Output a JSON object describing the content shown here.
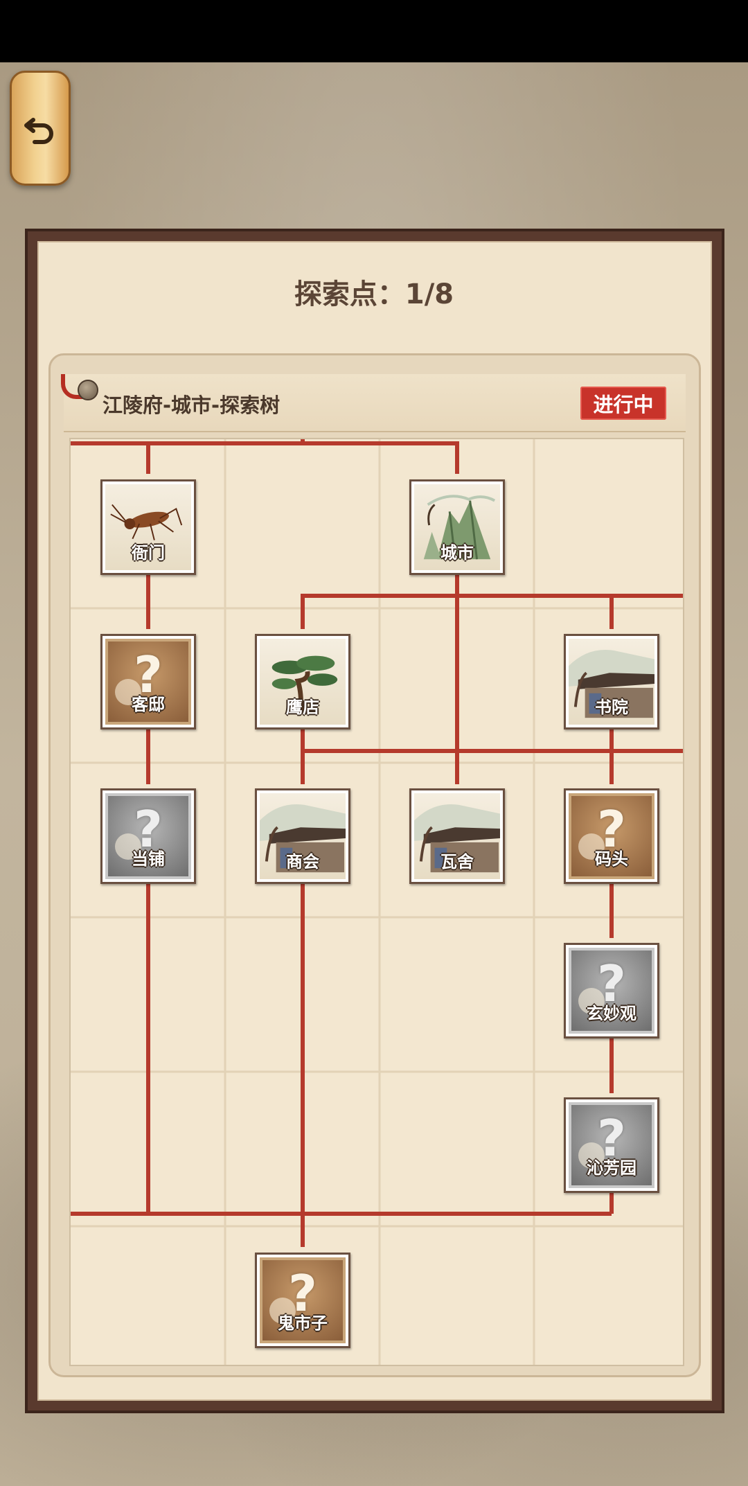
{
  "header": {
    "back_icon": "undo-arrow-icon",
    "title": "探索点：1/8"
  },
  "panel": {
    "title": "江陵府-城市-探索树",
    "status": "进行中"
  },
  "nodes": [
    {
      "id": "yamen",
      "label": "衙门",
      "state": "open",
      "art": "cricket"
    },
    {
      "id": "city",
      "label": "城市",
      "state": "open",
      "art": "mountain"
    },
    {
      "id": "inn",
      "label": "客邸",
      "state": "locked-brown",
      "art": "question"
    },
    {
      "id": "falcon",
      "label": "鹰店",
      "state": "open",
      "art": "pine"
    },
    {
      "id": "academy",
      "label": "书院",
      "state": "open",
      "art": "house"
    },
    {
      "id": "pawn",
      "label": "当铺",
      "state": "locked-gray",
      "art": "question"
    },
    {
      "id": "guild",
      "label": "商会",
      "state": "open",
      "art": "house"
    },
    {
      "id": "theater",
      "label": "瓦舍",
      "state": "open",
      "art": "house"
    },
    {
      "id": "pier",
      "label": "码头",
      "state": "locked-brown",
      "art": "question"
    },
    {
      "id": "temple",
      "label": "玄妙观",
      "state": "locked-gray",
      "art": "question"
    },
    {
      "id": "garden",
      "label": "沁芳园",
      "state": "locked-gray",
      "art": "question"
    },
    {
      "id": "ghostmarket",
      "label": "鬼市子",
      "state": "locked-brown",
      "art": "question"
    }
  ],
  "colors": {
    "line": "#b53a2c",
    "badge": "#c8332a",
    "frame": "#5a3a2e"
  }
}
